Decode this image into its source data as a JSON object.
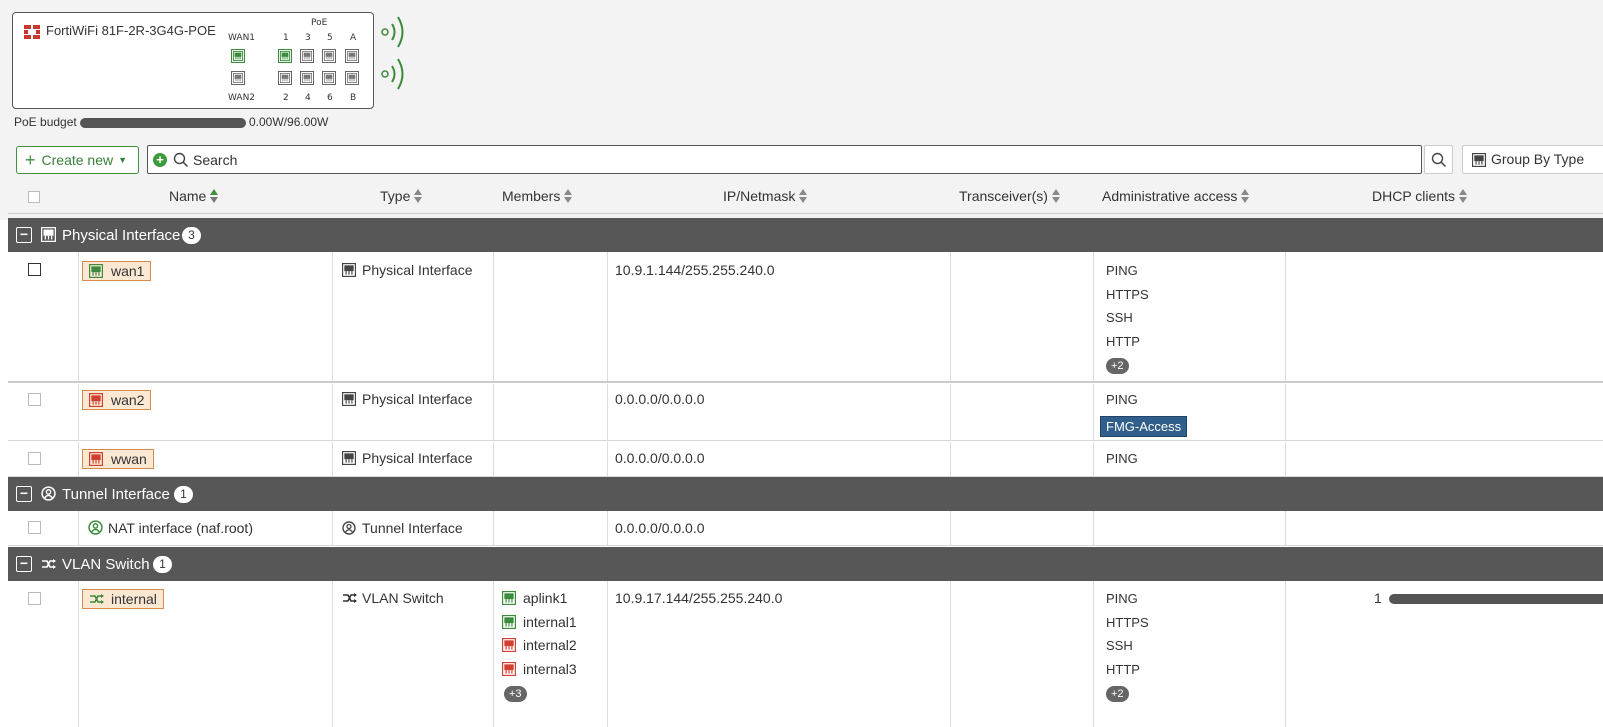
{
  "device": {
    "name": "FortiWiFi 81F-2R-3G4G-POE",
    "poe_label": "PoE",
    "wan1_label": "WAN1",
    "wan2_label": "WAN2",
    "top_port_labels": [
      "1",
      "3",
      "5",
      "A"
    ],
    "bottom_port_labels": [
      "2",
      "4",
      "6",
      "B"
    ]
  },
  "poe_budget": {
    "label": "PoE budget",
    "value": "0.00W/96.00W",
    "used_fraction": 0.0
  },
  "toolbar": {
    "create_label": "Create new",
    "search_placeholder": "Search",
    "group_by_label": "Group By Type"
  },
  "columns": {
    "name": "Name",
    "type": "Type",
    "members": "Members",
    "ip": "IP/Netmask",
    "transceivers": "Transceiver(s)",
    "access": "Administrative access",
    "dhcp": "DHCP clients"
  },
  "groups": {
    "physical": {
      "label": "Physical Interface",
      "count": "3"
    },
    "tunnel": {
      "label": "Tunnel Interface",
      "count": "1"
    },
    "vlan": {
      "label": "VLAN Switch",
      "count": "1"
    }
  },
  "rows": {
    "wan1": {
      "name": "wan1",
      "type": "Physical Interface",
      "ip": "10.9.1.144/255.255.240.0",
      "access": [
        "PING",
        "HTTPS",
        "SSH",
        "HTTP"
      ],
      "access_more": "+2"
    },
    "wan2": {
      "name": "wan2",
      "type": "Physical Interface",
      "ip": "0.0.0.0/0.0.0.0",
      "access": [
        "PING"
      ],
      "access_highlight": "FMG-Access"
    },
    "wwan": {
      "name": "wwan",
      "type": "Physical Interface",
      "ip": "0.0.0.0/0.0.0.0",
      "access": [
        "PING"
      ]
    },
    "nat": {
      "name": "NAT interface (naf.root)",
      "type": "Tunnel Interface",
      "ip": "0.0.0.0/0.0.0.0"
    },
    "internal": {
      "name": "internal",
      "type": "VLAN Switch",
      "ip": "10.9.17.144/255.255.240.0",
      "members": [
        "aplink1",
        "internal1",
        "internal2",
        "internal3"
      ],
      "members_more": "+3",
      "access": [
        "PING",
        "HTTPS",
        "SSH",
        "HTTP"
      ],
      "access_more": "+2",
      "dhcp_clients": "1"
    }
  },
  "colors": {
    "port_up": "#3c8a3c",
    "port_down": "#d04030",
    "group_bar": "#575757",
    "name_tag_bg": "#fbe8d3",
    "name_tag_border": "#d88a4a",
    "access_highlight": "#2f5f8a"
  }
}
